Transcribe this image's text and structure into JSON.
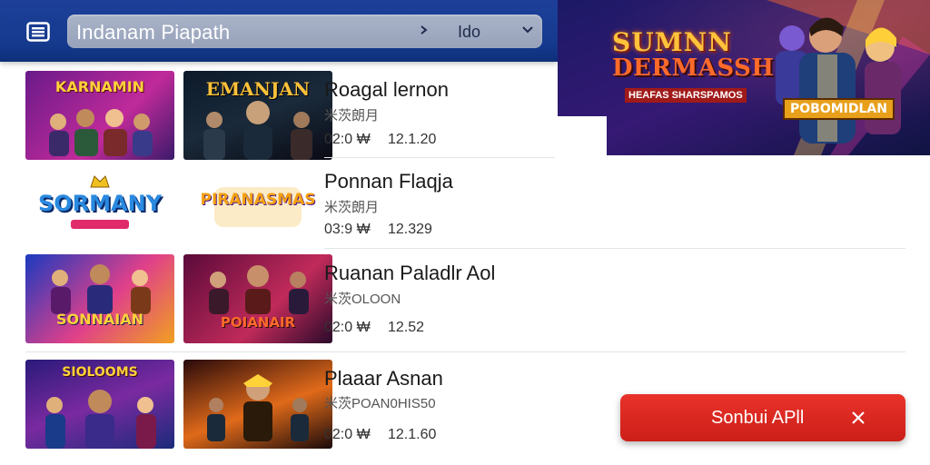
{
  "header": {
    "search_text": "Indanam Piapath",
    "search_value": "Ido",
    "accent": "#153a8e"
  },
  "banner": {
    "title_line1": "SUMNN",
    "title_line2": "DERMASSH",
    "tagline": "HEAFAS SHARSPAMOS",
    "badge": "POBOMIDLAN"
  },
  "list": [
    {
      "thumbs": [
        {
          "label": "KARNAMIN",
          "icon": "game-art-icon"
        },
        {
          "label": "EMANJAN",
          "icon": "game-art-icon"
        }
      ],
      "title": "Roagal lernon",
      "subtitle": "米茨朗月",
      "time": "02:0 ₩",
      "count": "12.1.20"
    },
    {
      "thumbs": [
        {
          "label": "SORMANY",
          "icon": "logo-icon"
        },
        {
          "label": "PIRANASMAS",
          "icon": "logo-icon"
        }
      ],
      "title": "Ponnan Flaqja",
      "subtitle": "米茨朗月",
      "time": "03:9 ₩",
      "count": "12.329"
    },
    {
      "thumbs": [
        {
          "label": "SONNAIAN",
          "icon": "game-art-icon"
        },
        {
          "label": "POIANAIR",
          "icon": "game-art-icon"
        }
      ],
      "title": "Ruanan Paladlr Aol",
      "subtitle": "米茨OLOON",
      "time": "02:0 ₩",
      "count": "12.52"
    },
    {
      "thumbs": [
        {
          "label": "SIOLOOMS",
          "icon": "game-art-icon"
        },
        {
          "label": "",
          "icon": "game-art-icon"
        }
      ],
      "title": "Plaaar Asnan",
      "subtitle": "米茨POAN0HIS50",
      "time": "02:0 ₩",
      "count": "12.1.60"
    }
  ],
  "toast": {
    "label": "Sonbui APll",
    "color": "#d9231c"
  }
}
